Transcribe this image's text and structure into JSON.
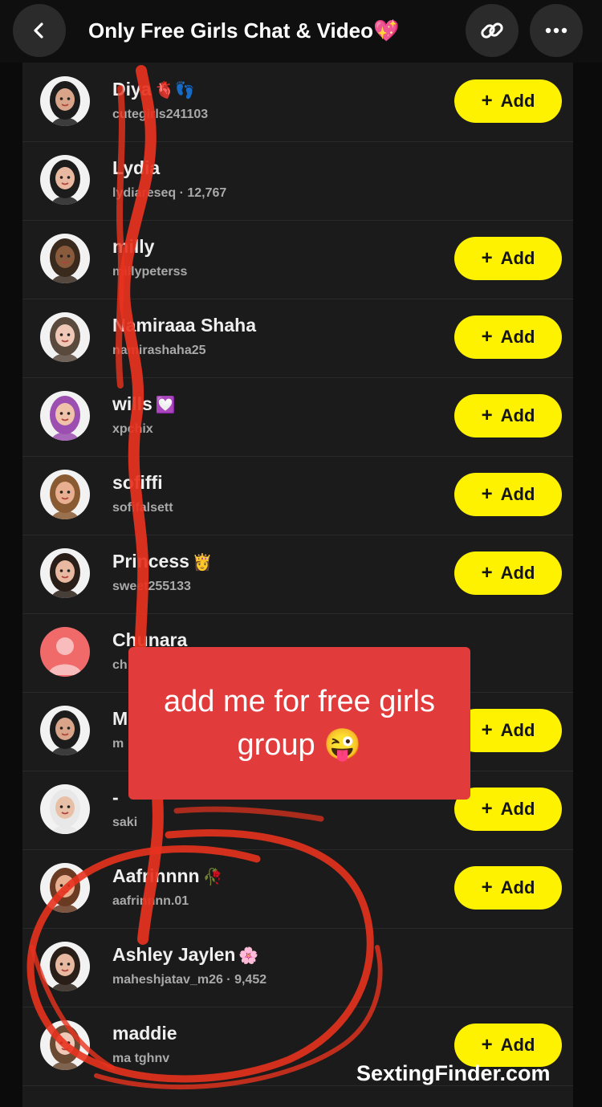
{
  "header": {
    "title": "Only Free Girls Chat & Video💖",
    "back_icon": "chevron-left-icon",
    "link_icon": "link-icon",
    "more_icon": "more-horizontal-icon"
  },
  "add_label": "Add",
  "members": [
    {
      "name": "Diya",
      "emoji": "🫀👣",
      "username": "cutegirls241103",
      "has_add": true,
      "avatar_bg": "#f2f2f2",
      "hair": "#1c1c1c",
      "skin": "#d9a58a"
    },
    {
      "name": "Lydia",
      "emoji": "",
      "username": "lydiareseq · 12,767",
      "has_add": false,
      "avatar_bg": "#f2f2f2",
      "hair": "#1c1c1c",
      "skin": "#e8b9a0"
    },
    {
      "name": "milly",
      "emoji": "",
      "username": "millypeterss",
      "has_add": true,
      "avatar_bg": "#f2f2f2",
      "hair": "#3a2a1e",
      "skin": "#8a5a3c"
    },
    {
      "name": "Namiraaa Shaha",
      "emoji": "",
      "username": "namirashaha25",
      "has_add": true,
      "avatar_bg": "#f2f2f2",
      "hair": "#5a4a3e",
      "skin": "#f0c8b8"
    },
    {
      "name": "wills",
      "emoji": "💟",
      "username": "xpchix",
      "has_add": true,
      "avatar_bg": "#f2f2f2",
      "hair": "#9c4fb0",
      "skin": "#f0c2aa"
    },
    {
      "name": "sofiffi",
      "emoji": "",
      "username": "sofifalsett",
      "has_add": true,
      "avatar_bg": "#f2f2f2",
      "hair": "#8a5a32",
      "skin": "#e8b090"
    },
    {
      "name": "Princess",
      "emoji": "👸",
      "username": "sweet255133",
      "has_add": true,
      "avatar_bg": "#f2f2f2",
      "hair": "#2a1e18",
      "skin": "#e8b9a0"
    },
    {
      "name": "Chunara",
      "emoji": "",
      "username": "ch",
      "has_add": false,
      "avatar_bg": "#f06a6a",
      "hair": "",
      "skin": ""
    },
    {
      "name": "M",
      "emoji": "",
      "username": "m",
      "has_add": true,
      "avatar_bg": "#f2f2f2",
      "hair": "#1c1c1c",
      "skin": "#d9a58a"
    },
    {
      "name": "-",
      "emoji": "",
      "username": "saki",
      "has_add": true,
      "avatar_bg": "#f2f2f2",
      "hair": "#e8e8e8",
      "skin": "#e8c0a8"
    },
    {
      "name": "Aafrinnnn",
      "emoji": "🥀",
      "username": "aafrinnnn.01",
      "has_add": true,
      "avatar_bg": "#f2f2f2",
      "hair": "#6a3a22",
      "skin": "#e8b090"
    },
    {
      "name": "Ashley Jaylen",
      "emoji": "🌸",
      "username": "maheshjatav_m26 · 9,452",
      "has_add": false,
      "avatar_bg": "#f2f2f2",
      "hair": "#2a1e18",
      "skin": "#e8b9a0"
    },
    {
      "name": "maddie",
      "emoji": "",
      "username": "ma tghnv",
      "has_add": true,
      "avatar_bg": "#f2f2f2",
      "hair": "#6a4a32",
      "skin": "#f0c8b8"
    }
  ],
  "sticker": {
    "line1": "add me for free girls",
    "line2": "group 😜"
  },
  "watermark": "SextingFinder.com",
  "colors": {
    "accent_yellow": "#fff200",
    "sticker_red": "#e23b3b",
    "scribble_red": "#e8321e"
  }
}
